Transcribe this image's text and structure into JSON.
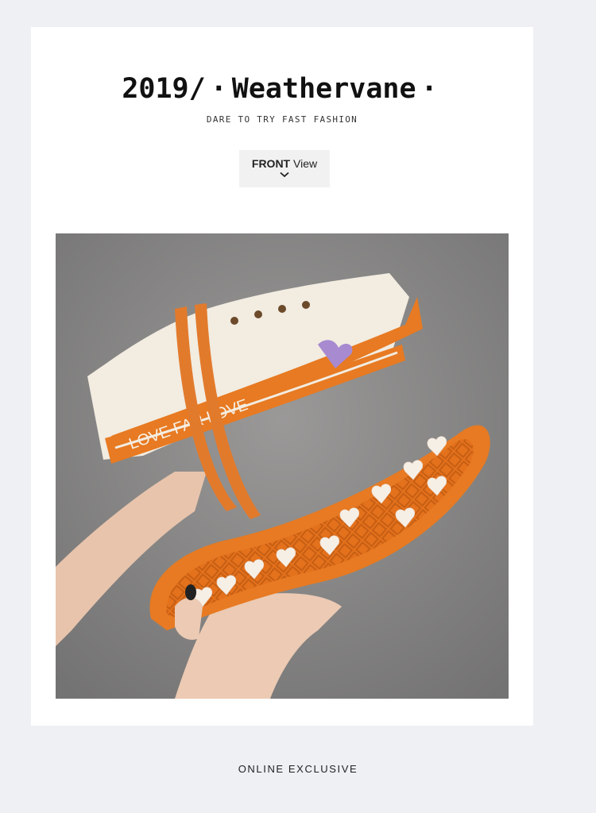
{
  "header": {
    "title_year": "2019/",
    "title_brand": "Weathervane",
    "title_dot": "·",
    "tagline": "DARE TO TRY FAST FASHION"
  },
  "view_badge": {
    "label_bold": "FRONT",
    "label_rest": "View",
    "icon": "chevron-down-icon"
  },
  "photo": {
    "sole_text": "LOVE",
    "side_text": "LOVE FAR LOVE",
    "colors": {
      "sole": "#e77a22",
      "canvas": "#f2ece1",
      "wall": "#8d8c8b"
    }
  },
  "footer": {
    "label": "ONLINE EXCLUSIVE"
  }
}
